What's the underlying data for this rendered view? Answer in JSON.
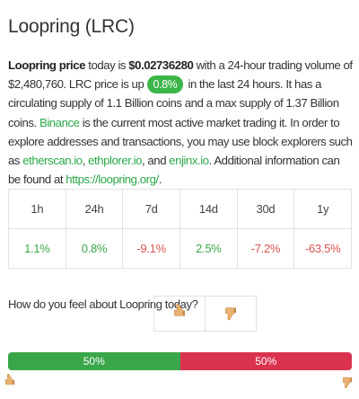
{
  "title": "Loopring (LRC)",
  "description": {
    "name": "Loopring price",
    "t1": " today is ",
    "price": "$0.02736280",
    "t2": " with a 24-hour trading volume of $2,480,760. LRC price is up ",
    "badge": "0.8%",
    "t3": " in the last 24 hours. It has a circulating supply of 1.1 Billion coins and a max supply of 1.37 Billion coins. ",
    "exchange": "Binance",
    "t4": " is the current most active market trading it. In order to explore addresses and transactions, you may use block explorers such as ",
    "explorer1": "etherscan.io",
    "sep1": ", ",
    "explorer2": "ethplorer.io",
    "sep2": ", and ",
    "explorer3": "enjinx.io",
    "t5": ". Additional information can be found at ",
    "website": "https://loopring.org/",
    "t6": "."
  },
  "changes": {
    "headers": [
      "1h",
      "24h",
      "7d",
      "14d",
      "30d",
      "1y"
    ],
    "values": [
      "1.1%",
      "0.8%",
      "-9.1%",
      "2.5%",
      "-7.2%",
      "-63.5%"
    ]
  },
  "colors": {
    "positive": "#3aa64a",
    "negative": "#d9334f"
  },
  "sentiment": {
    "question": "How do you feel about Loopring today?",
    "up_icon": "thumbs-up-icon",
    "down_icon": "thumbs-down-icon",
    "up_label": "50%",
    "down_label": "50%",
    "up_fraction": 0.5,
    "down_fraction": 0.5
  }
}
